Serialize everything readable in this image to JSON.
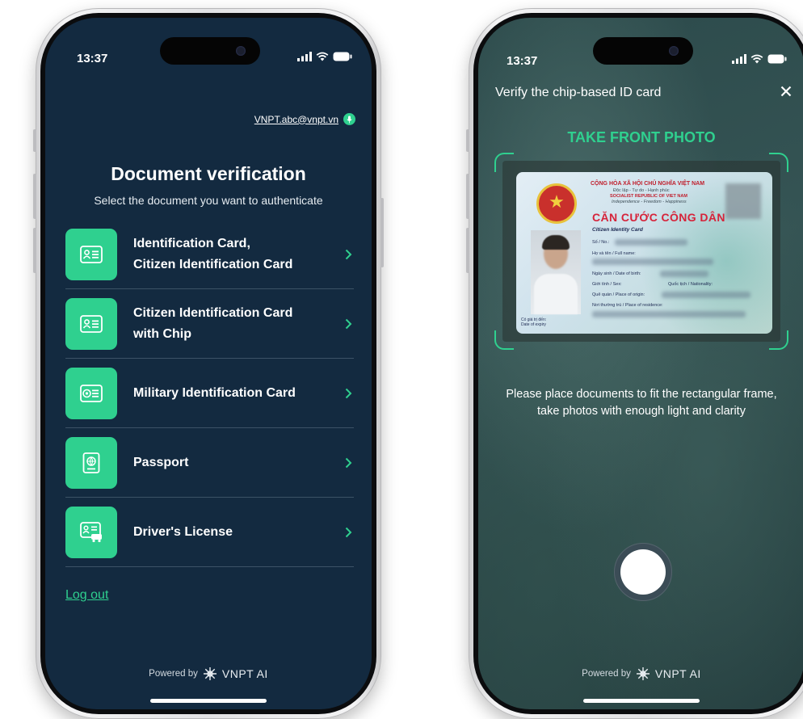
{
  "left_screen": {
    "status_time": "13:37",
    "user_email": "VNPT.abc@vnpt.vn",
    "title": "Document verification",
    "subtitle": "Select the document you want to authenticate",
    "documents": [
      {
        "label": "Identification Card,\nCitizen Identification Card",
        "icon": "id-card-icon"
      },
      {
        "label": "Citizen Identification Card\nwith Chip",
        "icon": "chip-id-card-icon"
      },
      {
        "label": "Military Identification Card",
        "icon": "military-id-icon"
      },
      {
        "label": "Passport",
        "icon": "passport-icon"
      },
      {
        "label": "Driver's License",
        "icon": "drivers-license-icon"
      }
    ],
    "logout": "Log out",
    "powered_by": "Powered by",
    "brand": "VNPT AI"
  },
  "right_screen": {
    "status_time": "13:37",
    "title": "Verify the chip-based ID card",
    "close_icon": "close-icon",
    "instruction_title": "TAKE FRONT PHOTO",
    "card": {
      "header_1": "CỘNG HÒA XÃ HỘI CHỦ NGHĨA VIỆT NAM",
      "header_2": "Độc lập - Tự do - Hạnh phúc",
      "header_3": "SOCIALIST REPUBLIC OF VIET NAM",
      "header_4": "Independence - Freedom - Happiness",
      "title": "CĂN CƯỚC CÔNG DÂN",
      "subtitle": "Citizen Identity Card",
      "field_no": "Số / No.:",
      "field_name": "Họ và tên / Full name:",
      "field_dob": "Ngày sinh / Date of birth:",
      "field_sex": "Giới tính / Sex:",
      "field_nationality": "Quốc tịch / Nationality:",
      "field_origin": "Quê quán / Place of origin:",
      "field_residence": "Nơi thường trú / Place of residence:",
      "field_expiry_1": "Có giá trị đến:",
      "field_expiry_2": "Date of expiry"
    },
    "instruction_text": "Please place documents to fit the rectangular frame, take photos with enough light and clarity",
    "powered_by": "Powered by",
    "brand": "VNPT AI"
  },
  "colors": {
    "accent": "#2fd08f",
    "left_background": "#132a40",
    "camera_background": "#2c4a4b"
  }
}
